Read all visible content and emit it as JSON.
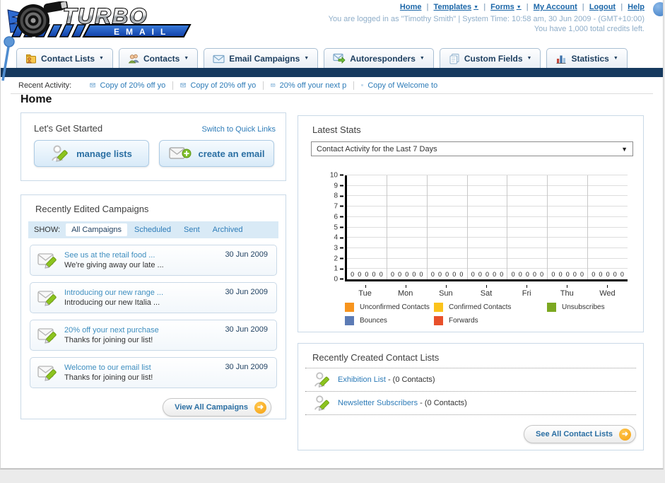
{
  "colors": {
    "accent_link": "#2E7CB8",
    "navy_band": "#16395E",
    "brand_blue": "#1E52C4",
    "orange_arrow": "#F5A112",
    "panel_border": "#C9D9E7"
  },
  "header": {
    "logo": {
      "brand": "TURBO",
      "sub": "EMAIL"
    },
    "separator": "|",
    "nav": [
      {
        "label": "Home"
      },
      {
        "label": "Templates"
      },
      {
        "label": "Forms"
      },
      {
        "label": "My Account"
      },
      {
        "label": "Logout"
      },
      {
        "label": "Help"
      }
    ],
    "login_line": "You are logged in as \"Timothy Smith\" | System Time: 10:58 am, 30 Jun 2009 - (GMT+10:00)",
    "credits_line": "You have 1,000 total credits left."
  },
  "tabs": [
    {
      "label": "Contact Lists"
    },
    {
      "label": "Contacts"
    },
    {
      "label": "Email Campaigns"
    },
    {
      "label": "Autoresponders"
    },
    {
      "label": "Custom Fields"
    },
    {
      "label": "Statistics"
    }
  ],
  "recent_activity": {
    "label": "Recent Activity:",
    "items": [
      "Copy of 20% off yo",
      "Copy of 20% off yo",
      "20% off your next p",
      "Copy of Welcome to"
    ]
  },
  "main": {
    "page_title": "Home",
    "get_started": {
      "title": "Let's Get Started",
      "switch_link": "Switch to Quick Links",
      "buttons": [
        {
          "label": "manage lists"
        },
        {
          "label": "create an email"
        }
      ]
    },
    "campaigns": {
      "title": "Recently Edited Campaigns",
      "show_label": "SHOW:",
      "filters": [
        {
          "label": "All Campaigns"
        },
        {
          "label": "Scheduled"
        },
        {
          "label": "Sent"
        },
        {
          "label": "Archived"
        }
      ],
      "items": [
        {
          "title": "See us at the retail food ...",
          "subtitle": "We're giving away our late ...",
          "date": "30 Jun 2009"
        },
        {
          "title": "Introducing our new range ...",
          "subtitle": "Introducing our new Italia ...",
          "date": "30 Jun 2009"
        },
        {
          "title": "20% off your next purchase",
          "subtitle": "Thanks for joining our list!",
          "date": "30 Jun 2009"
        },
        {
          "title": "Welcome to our email list",
          "subtitle": "Thanks for joining our list!",
          "date": "30 Jun 2009"
        }
      ],
      "view_all": "View All Campaigns"
    },
    "stats": {
      "title": "Latest Stats",
      "selected_option": "Contact Activity for the Last 7 Days"
    },
    "contact_lists": {
      "title": "Recently Created Contact Lists",
      "items": [
        {
          "name": "Exhibition List",
          "detail": "- (0 Contacts)"
        },
        {
          "name": "Newsletter Subscribers",
          "detail": "- (0 Contacts)"
        }
      ],
      "see_all": "See All Contact Lists"
    }
  },
  "chart_data": {
    "type": "bar",
    "title": "Contact Activity for the Last 7 Days",
    "categories": [
      "Tue",
      "Mon",
      "Sun",
      "Sat",
      "Fri",
      "Thu",
      "Wed"
    ],
    "series": [
      {
        "name": "Unconfirmed Contacts",
        "color": "#F7941E",
        "values": [
          0,
          0,
          0,
          0,
          0,
          0,
          0
        ]
      },
      {
        "name": "Confirmed Contacts",
        "color": "#FBC31B",
        "values": [
          0,
          0,
          0,
          0,
          0,
          0,
          0
        ]
      },
      {
        "name": "Unsubscribes",
        "color": "#7CA821",
        "values": [
          0,
          0,
          0,
          0,
          0,
          0,
          0
        ]
      },
      {
        "name": "Bounces",
        "color": "#5C7BB5",
        "values": [
          0,
          0,
          0,
          0,
          0,
          0,
          0
        ]
      },
      {
        "name": "Forwards",
        "color": "#E8502B",
        "values": [
          0,
          0,
          0,
          0,
          0,
          0,
          0
        ]
      }
    ],
    "ylim": [
      0,
      10
    ],
    "yticks": [
      0,
      1,
      2,
      3,
      4,
      5,
      6,
      7,
      8,
      9,
      10
    ],
    "grid": true,
    "legend_position": "bottom"
  }
}
